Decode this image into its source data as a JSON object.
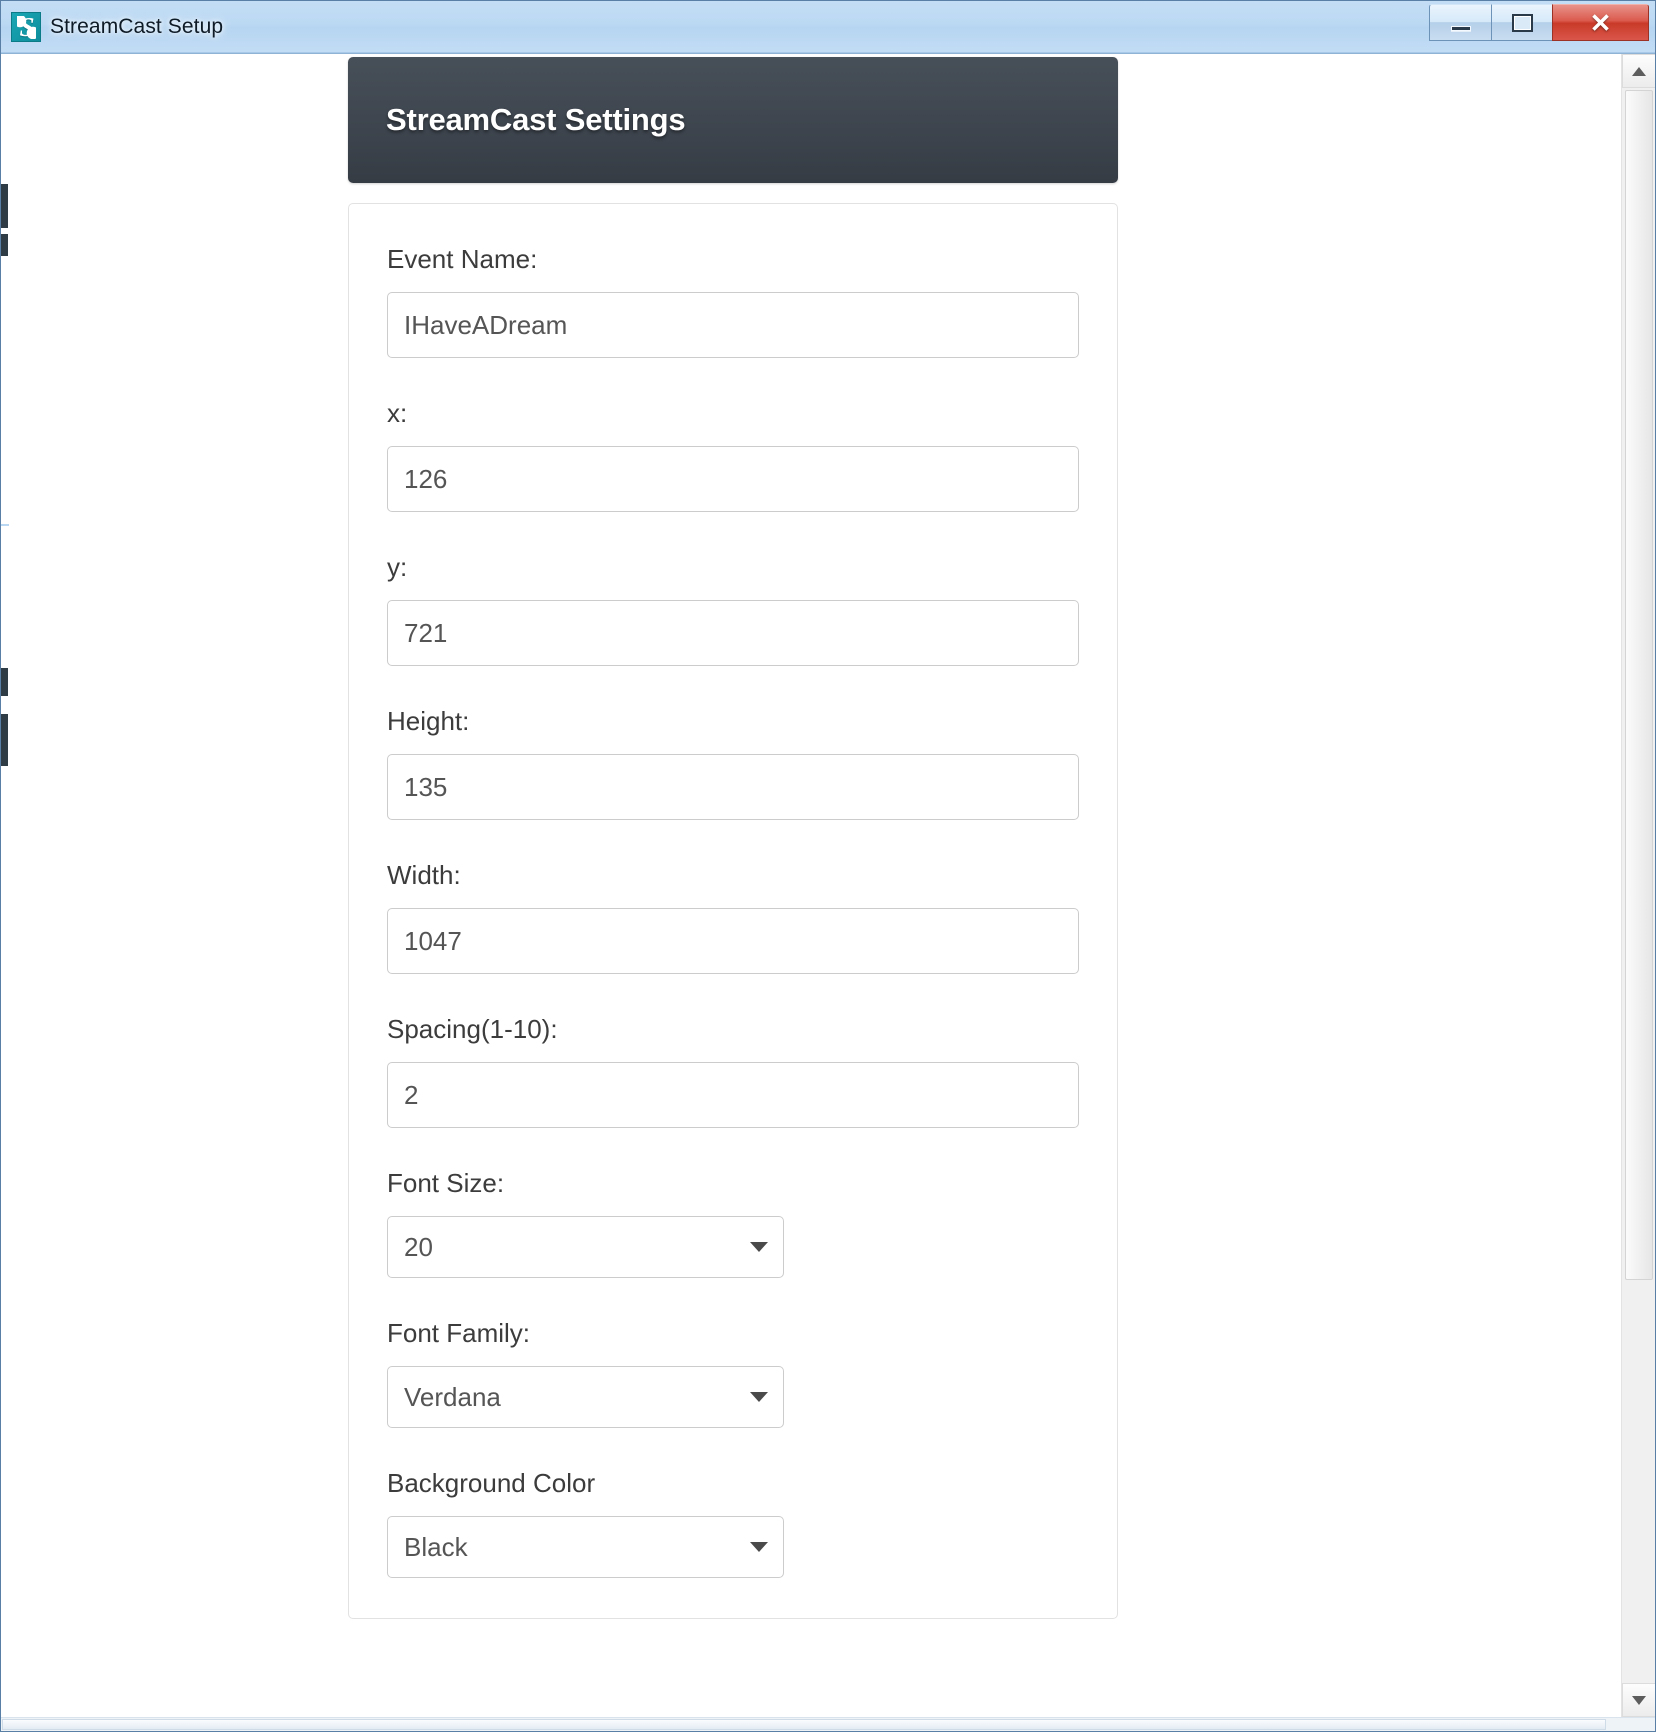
{
  "window": {
    "title": "StreamCast Setup",
    "icon": "app-logo-icon",
    "logo_glyph": "S",
    "controls": {
      "minimize": "–",
      "maximize": "❐",
      "close": "✕"
    }
  },
  "header": {
    "title": "StreamCast Settings"
  },
  "form": {
    "fields": [
      {
        "type": "text",
        "name": "event-name",
        "label": "Event Name:",
        "value": "IHaveADream",
        "placeholder": ""
      },
      {
        "type": "text",
        "name": "x",
        "label": "x:",
        "value": "126",
        "placeholder": ""
      },
      {
        "type": "text",
        "name": "y",
        "label": "y:",
        "value": "721",
        "placeholder": ""
      },
      {
        "type": "text",
        "name": "height",
        "label": "Height:",
        "value": "135",
        "placeholder": ""
      },
      {
        "type": "text",
        "name": "width",
        "label": "Width:",
        "value": "1047",
        "placeholder": ""
      },
      {
        "type": "text",
        "name": "spacing",
        "label": "Spacing(1-10):",
        "value": "2",
        "placeholder": ""
      },
      {
        "type": "select",
        "name": "font-size",
        "label": "Font Size:",
        "value": "20"
      },
      {
        "type": "select",
        "name": "font-family",
        "label": "Font Family:",
        "value": "Verdana"
      },
      {
        "type": "select",
        "name": "background-color",
        "label": "Background Color",
        "value": "Black"
      }
    ]
  },
  "colors": {
    "header_bg": "#3e454e",
    "titlebar": "#bcd9f3",
    "close_button": "#c93a28",
    "accent": "#0e8d9c",
    "input_border": "#cccccc",
    "text": "#3c3c3c"
  },
  "scrollbar": {
    "up_arrow": "scroll-up-icon",
    "down_arrow": "scroll-down-icon"
  }
}
